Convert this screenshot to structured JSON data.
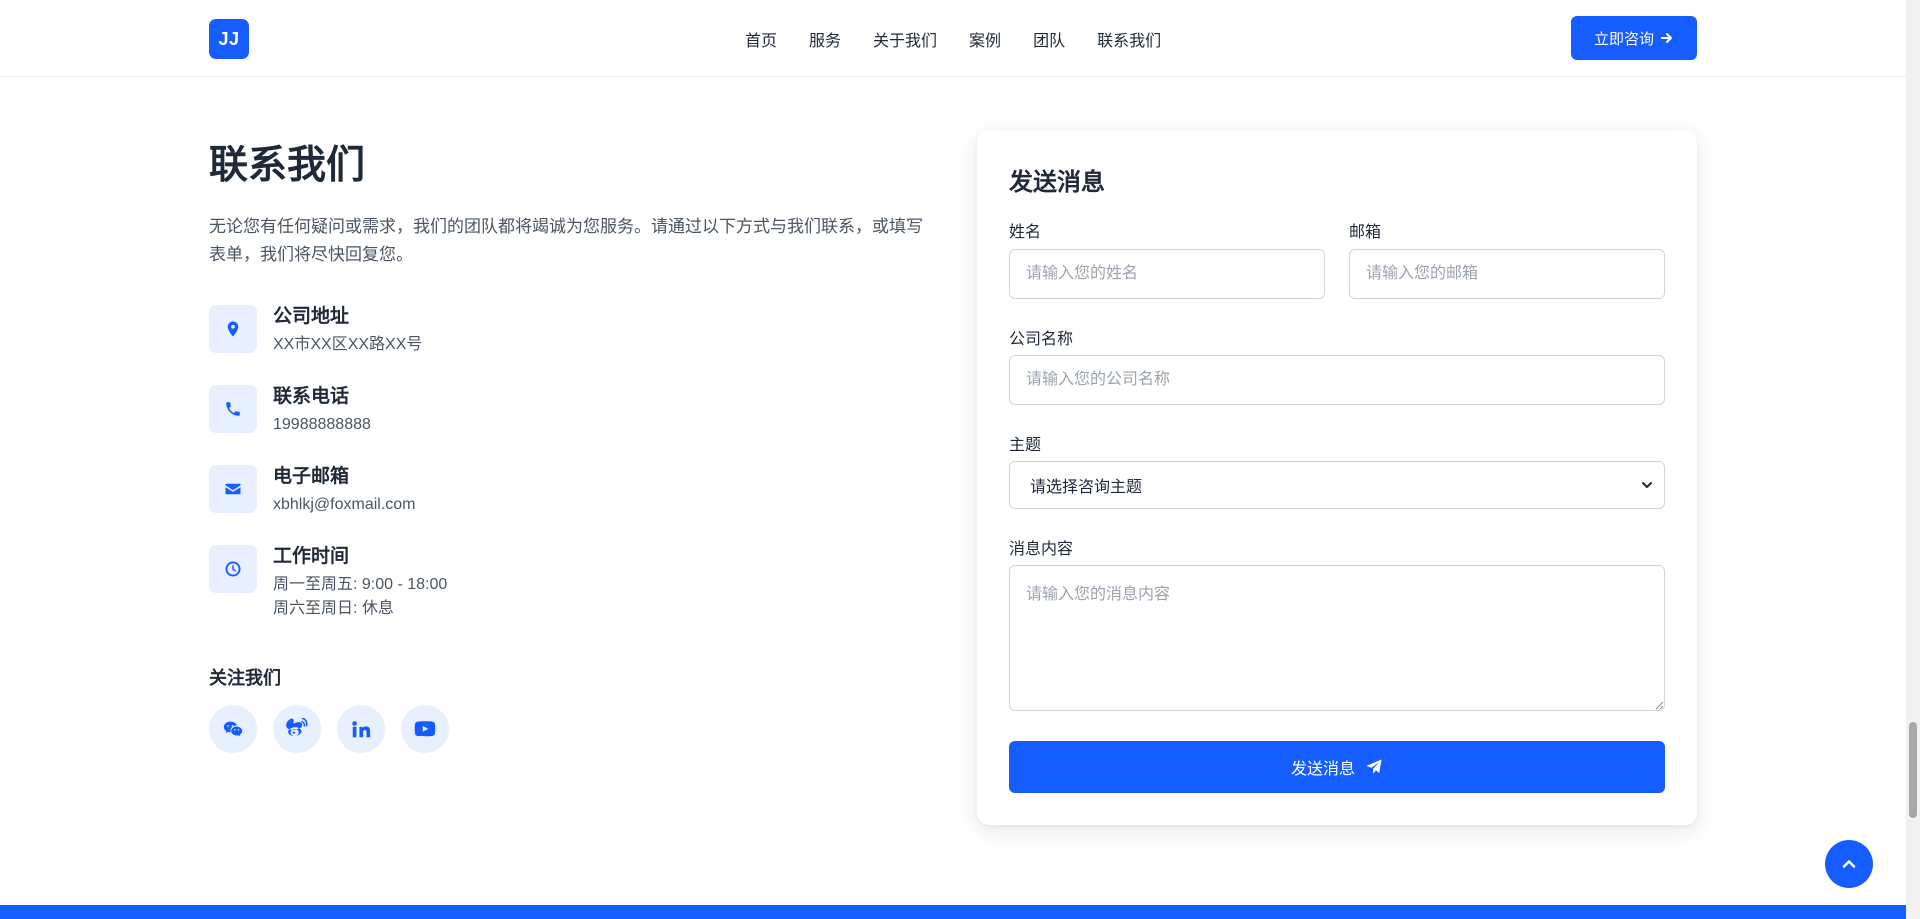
{
  "header": {
    "logo_text": "JJ",
    "nav": [
      "首页",
      "服务",
      "关于我们",
      "案例",
      "团队",
      "联系我们"
    ],
    "cta_label": "立即咨询"
  },
  "contact": {
    "title": "联系我们",
    "description": "无论您有任何疑问或需求，我们的团队都将竭诚为您服务。请通过以下方式与我们联系，或填写表单，我们将尽快回复您。",
    "items": [
      {
        "icon": "map-pin-icon",
        "label": "公司地址",
        "value": "XX市XX区XX路XX号"
      },
      {
        "icon": "phone-icon",
        "label": "联系电话",
        "value": "19988888888"
      },
      {
        "icon": "envelope-icon",
        "label": "电子邮箱",
        "value": "xbhlkj@foxmail.com"
      },
      {
        "icon": "clock-icon",
        "label": "工作时间",
        "value": "周一至周五: 9:00 - 18:00",
        "value2": "周六至周日: 休息"
      }
    ],
    "follow_title": "关注我们",
    "socials": [
      "wechat-icon",
      "weibo-icon",
      "linkedin-icon",
      "youtube-icon"
    ]
  },
  "form": {
    "title": "发送消息",
    "name_label": "姓名",
    "name_placeholder": "请输入您的姓名",
    "email_label": "邮箱",
    "email_placeholder": "请输入您的邮箱",
    "company_label": "公司名称",
    "company_placeholder": "请输入您的公司名称",
    "subject_label": "主题",
    "subject_selected": "请选择咨询主题",
    "message_label": "消息内容",
    "message_placeholder": "请输入您的消息内容",
    "submit_label": "发送消息"
  },
  "colors": {
    "primary": "#165dff",
    "icon_bg": "#e8efff"
  }
}
